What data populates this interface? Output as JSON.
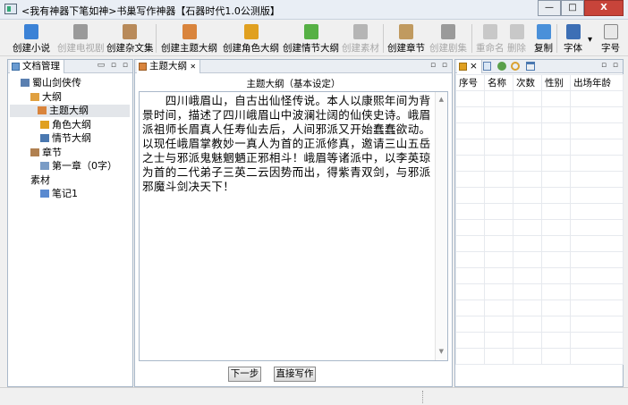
{
  "window": {
    "title": "<我有神器下笔如神>书巢写作神器【石器时代1.0公测版】",
    "close": "X"
  },
  "toolbar": [
    {
      "label": "创建小说",
      "enabled": true,
      "color": "#3b82d6"
    },
    {
      "label": "创建电视剧",
      "enabled": false,
      "color": "#9a9a9a"
    },
    {
      "label": "创建杂文集",
      "enabled": true,
      "color": "#b88a5a"
    },
    {
      "label": "创建主题大纲",
      "enabled": true,
      "color": "#d9843c"
    },
    {
      "label": "创建角色大纲",
      "enabled": true,
      "color": "#e0a020"
    },
    {
      "label": "创建情节大纲",
      "enabled": true,
      "color": "#56b045"
    },
    {
      "label": "创建素材",
      "enabled": false,
      "color": "#b5b5b5"
    },
    {
      "label": "创建章节",
      "enabled": true,
      "color": "#c09a60"
    },
    {
      "label": "创建剧集",
      "enabled": false,
      "color": "#9a9a9a"
    },
    {
      "label": "重命名",
      "enabled": false,
      "color": "#c8c8c8"
    },
    {
      "label": "删除",
      "enabled": false,
      "color": "#c8c8c8"
    },
    {
      "label": "复制",
      "enabled": true,
      "color": "#4a90d9"
    },
    {
      "label": "字体",
      "enabled": true,
      "color": "#3d6fb5"
    },
    {
      "label": "字号",
      "enabled": true,
      "color": "#e8e8e8"
    }
  ],
  "left_panel": {
    "tab": "文档管理",
    "tree": [
      {
        "label": "蜀山剑侠传",
        "level": 0
      },
      {
        "label": "大纲",
        "level": 1
      },
      {
        "label": "主题大纲",
        "level": 2,
        "selected": true
      },
      {
        "label": "角色大纲",
        "level": 2
      },
      {
        "label": "情节大纲",
        "level": 2
      },
      {
        "label": "章节",
        "level": 1
      },
      {
        "label": "第一章（0字）",
        "level": 2
      },
      {
        "label": "素材",
        "level": 1
      },
      {
        "label": "笔记1",
        "level": 2
      }
    ]
  },
  "editor": {
    "tab": "主题大纲",
    "tab_close": "✕",
    "heading": "主题大纲（基本设定）",
    "text": "　　四川峨眉山，自古出仙怪传说。本人以康熙年间为背景时间，描述了四川峨眉山中波澜壮阔的仙侠史诗。峨眉派祖师长眉真人任寿仙去后，人间邪派又开始蠢蠢欲动。以现任峨眉掌教妙一真人为首的正派修真，邀请三山五岳之士与邪派鬼魅魍魉正邪相斗！峨眉等诸派中，以李英琼为首的二代弟子三英二云因势而出，得紫青双剑，与邪派邪魔斗剑决天下！",
    "next_button": "下一步",
    "write_button": "直接写作"
  },
  "right_panel": {
    "columns": [
      "序号",
      "名称",
      "次数",
      "性别",
      "出场年龄"
    ]
  }
}
